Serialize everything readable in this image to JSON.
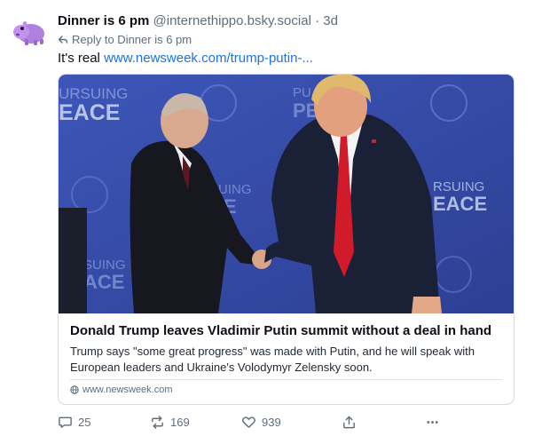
{
  "post": {
    "author": {
      "display_name": "Dinner is 6 pm",
      "handle": "@internethippo.bsky.social",
      "separator": "·",
      "time": "3d"
    },
    "reply_to": "Reply to Dinner is 6 pm",
    "text": "It's real",
    "link_text": "www.newsweek.com/trump-putin-..."
  },
  "card": {
    "image_texts": {
      "left_top_1": "URSUING",
      "left_top_2": "EACE",
      "center_top_1": "PU",
      "center_top_2": "PE",
      "mid_1": "SUING",
      "mid_2": "CE",
      "right_1": "RSUING",
      "right_2": "EACE",
      "low_left_1": "SUING",
      "low_left_2": "ACE"
    },
    "title": "Donald Trump leaves Vladimir Putin summit without a deal in hand",
    "description": "Trump says \"some great progress\" was made with Putin, and he will speak with European leaders and Ukraine's Volodymyr Zelensky soon.",
    "domain": "www.newsweek.com"
  },
  "actions": {
    "replies": "25",
    "reposts": "169",
    "likes": "939"
  },
  "icons": {
    "reply": "speech-bubble-icon",
    "repost": "repost-arrows-icon",
    "like": "heart-icon",
    "share": "share-icon",
    "more": "more-dots-icon",
    "globe": "globe-icon"
  },
  "colors": {
    "link": "#1a73e8",
    "muted": "#5f6d7a",
    "avatar": "#b07fe0",
    "backdrop": "#3a4fae"
  }
}
